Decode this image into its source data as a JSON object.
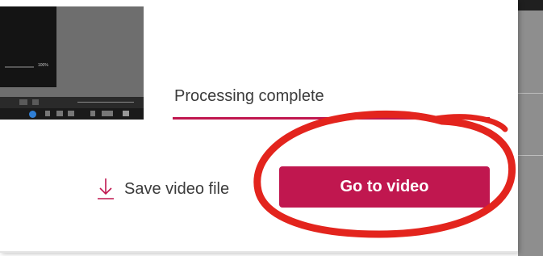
{
  "status": {
    "text": "Processing complete"
  },
  "actions": {
    "save_label": "Save video file",
    "go_label": "Go to video"
  },
  "thumbnail": {
    "zoom_label": "100%"
  },
  "icons": {
    "save": "download-icon",
    "help": "help-icon"
  },
  "colors": {
    "accent": "#c0174f",
    "annotation": "#e3241d",
    "text": "#3b3b3b"
  }
}
